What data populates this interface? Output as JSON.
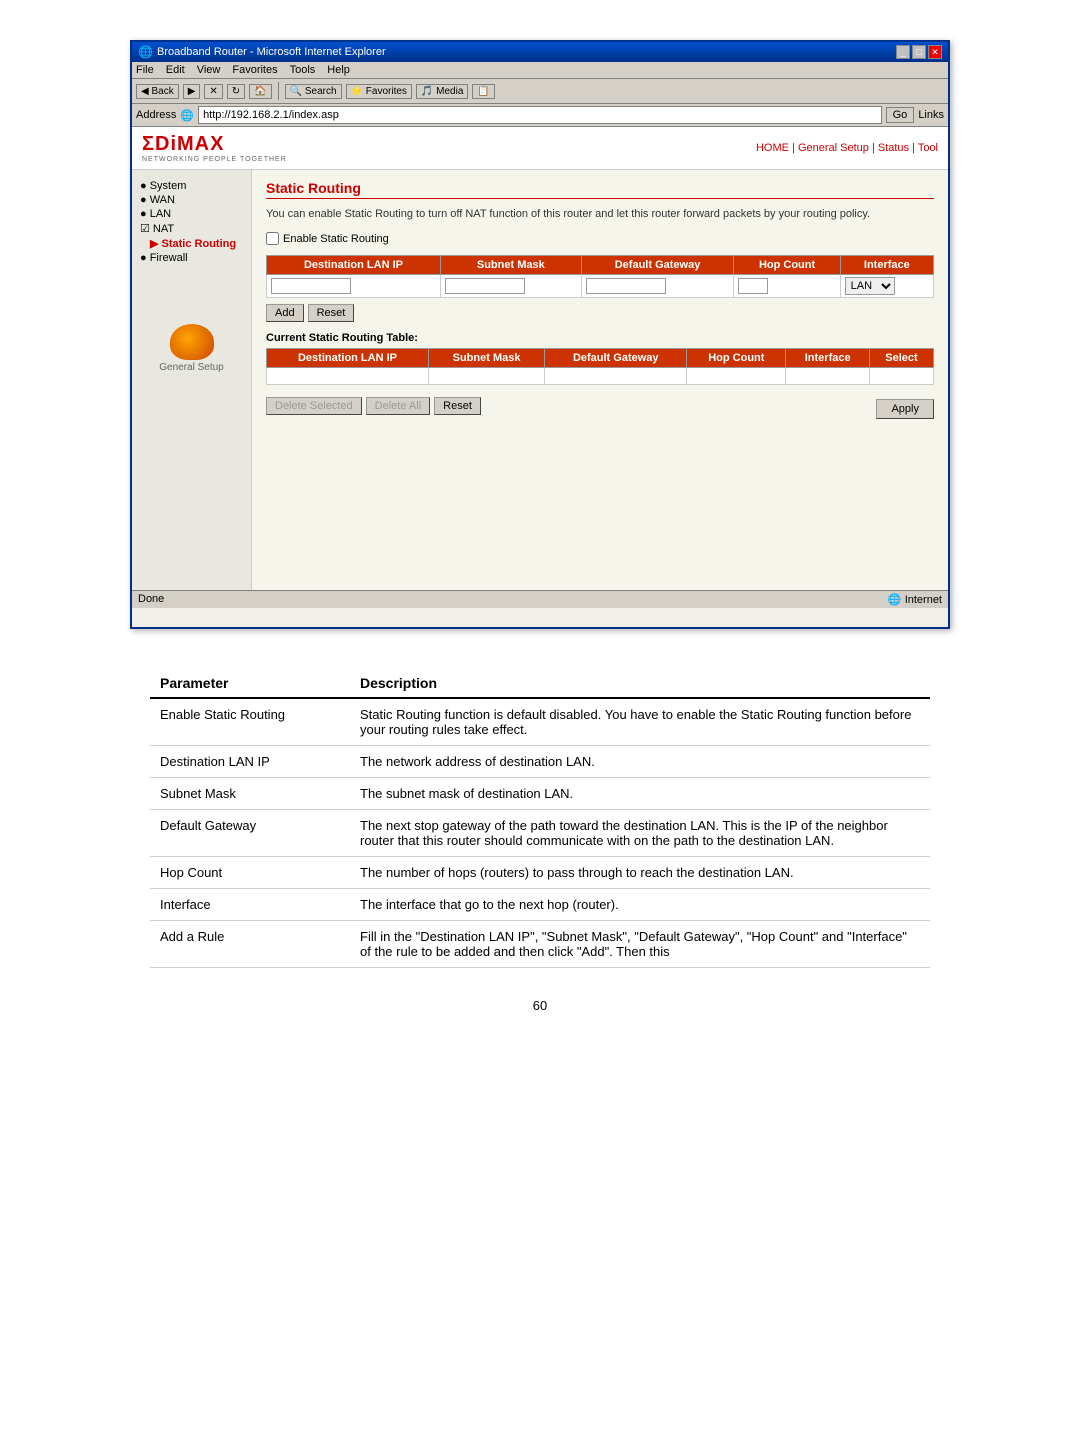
{
  "browser": {
    "title": "Broadband Router - Microsoft Internet Explorer",
    "menu_items": [
      "File",
      "Edit",
      "View",
      "Favorites",
      "Tools",
      "Help"
    ],
    "toolbar_buttons": [
      "Back",
      "Forward",
      "Stop",
      "Refresh",
      "Home",
      "Search",
      "Favorites",
      "Media",
      "History"
    ],
    "address_label": "Address",
    "address_value": "http://192.168.2.1/index.asp",
    "go_label": "Go",
    "links_label": "Links"
  },
  "router": {
    "logo": "ΣDiMAX",
    "logo_text": "EDIMAX",
    "tagline": "NETWORKING PEOPLE TOGETHER",
    "nav": "HOME | General Setup | Status | Tool",
    "page_title": "Static Routing",
    "description": "You can enable Static Routing to turn off NAT function of this router and let this router forward packets by your routing policy.",
    "enable_checkbox_label": "Enable Static Routing",
    "form_table": {
      "headers": [
        "Destination LAN IP",
        "Subnet Mask",
        "Default Gateway",
        "Hop Count",
        "Interface"
      ],
      "interface_default": "LAN"
    },
    "buttons": {
      "add": "Add",
      "reset": "Reset",
      "delete_selected": "Delete Selected",
      "delete_all": "Delete All",
      "reset2": "Reset",
      "apply": "Apply"
    },
    "current_table_title": "Current Static Routing Table:",
    "current_table_headers": [
      "Destination LAN IP",
      "Subnet Mask",
      "Default Gateway",
      "Hop Count",
      "Interface",
      "Select"
    ],
    "sidebar": {
      "items": [
        {
          "label": "System",
          "dot": true
        },
        {
          "label": "WAN",
          "dot": true
        },
        {
          "label": "LAN",
          "dot": true
        },
        {
          "label": "NAT",
          "dot": true,
          "checked": true
        },
        {
          "label": "Static Routing",
          "sub": true,
          "active": true
        },
        {
          "label": "Firewall",
          "dot": true
        }
      ],
      "bottom_label": "General Setup"
    },
    "status_bar": {
      "left": "Done",
      "right": "Internet"
    }
  },
  "doc_table": {
    "headers": [
      "Parameter",
      "Description"
    ],
    "rows": [
      {
        "param": "Enable Static Routing",
        "desc": "Static Routing function is default disabled. You have to enable the Static Routing function before your routing rules take effect."
      },
      {
        "param": "Destination LAN IP",
        "desc": "The network address of destination LAN."
      },
      {
        "param": "Subnet Mask",
        "desc": "The subnet mask of destination LAN."
      },
      {
        "param": "Default Gateway",
        "desc": "The next stop gateway of the path toward the destination LAN. This is the IP of the neighbor router that this router should communicate with on the path to the destination LAN."
      },
      {
        "param": "Hop Count",
        "desc": "The number of hops (routers) to pass through to reach the destination LAN."
      },
      {
        "param": "Interface",
        "desc": "The interface that go to the next hop (router)."
      },
      {
        "param": "Add a Rule",
        "desc": "Fill in the \"Destination LAN IP\", \"Subnet Mask\", \"Default Gateway\", \"Hop Count\" and \"Interface\" of the rule to be added and then click \"Add\". Then this"
      }
    ]
  },
  "page_number": "60"
}
